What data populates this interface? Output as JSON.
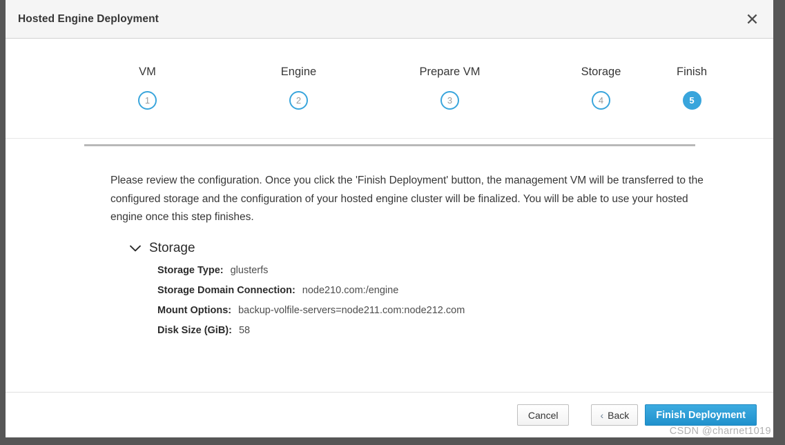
{
  "window": {
    "title": "Hosted Engine Deployment",
    "close_icon": "close-icon"
  },
  "stepper": {
    "steps": [
      {
        "label": "VM",
        "number": "1",
        "active": false
      },
      {
        "label": "Engine",
        "number": "2",
        "active": false
      },
      {
        "label": "Prepare VM",
        "number": "3",
        "active": false
      },
      {
        "label": "Storage",
        "number": "4",
        "active": false
      },
      {
        "label": "Finish",
        "number": "5",
        "active": true
      }
    ],
    "accent_color": "#39a5dc",
    "connector_color": "#b8b8b8"
  },
  "body": {
    "intro": "Please review the configuration. Once you click the 'Finish Deployment' button, the management VM will be transferred to the configured storage and the configuration of your hosted engine cluster will be finalized. You will be able to use your hosted engine once this step finishes.",
    "section": {
      "title": "Storage",
      "expanded": true,
      "chevron_icon": "chevron-down-icon",
      "details": [
        {
          "label": "Storage Type:",
          "value": "glusterfs"
        },
        {
          "label": "Storage Domain Connection:",
          "value": "node210.com:/engine"
        },
        {
          "label": "Mount Options:",
          "value": "backup-volfile-servers=node211.com:node212.com"
        },
        {
          "label": "Disk Size (GiB):",
          "value": "58"
        }
      ]
    }
  },
  "footer": {
    "cancel_label": "Cancel",
    "back_chevron": "‹",
    "back_label": "Back",
    "finish_label": "Finish Deployment",
    "primary_color": "#2091cd"
  },
  "watermark": {
    "text": "CSDN @charnet1019"
  }
}
